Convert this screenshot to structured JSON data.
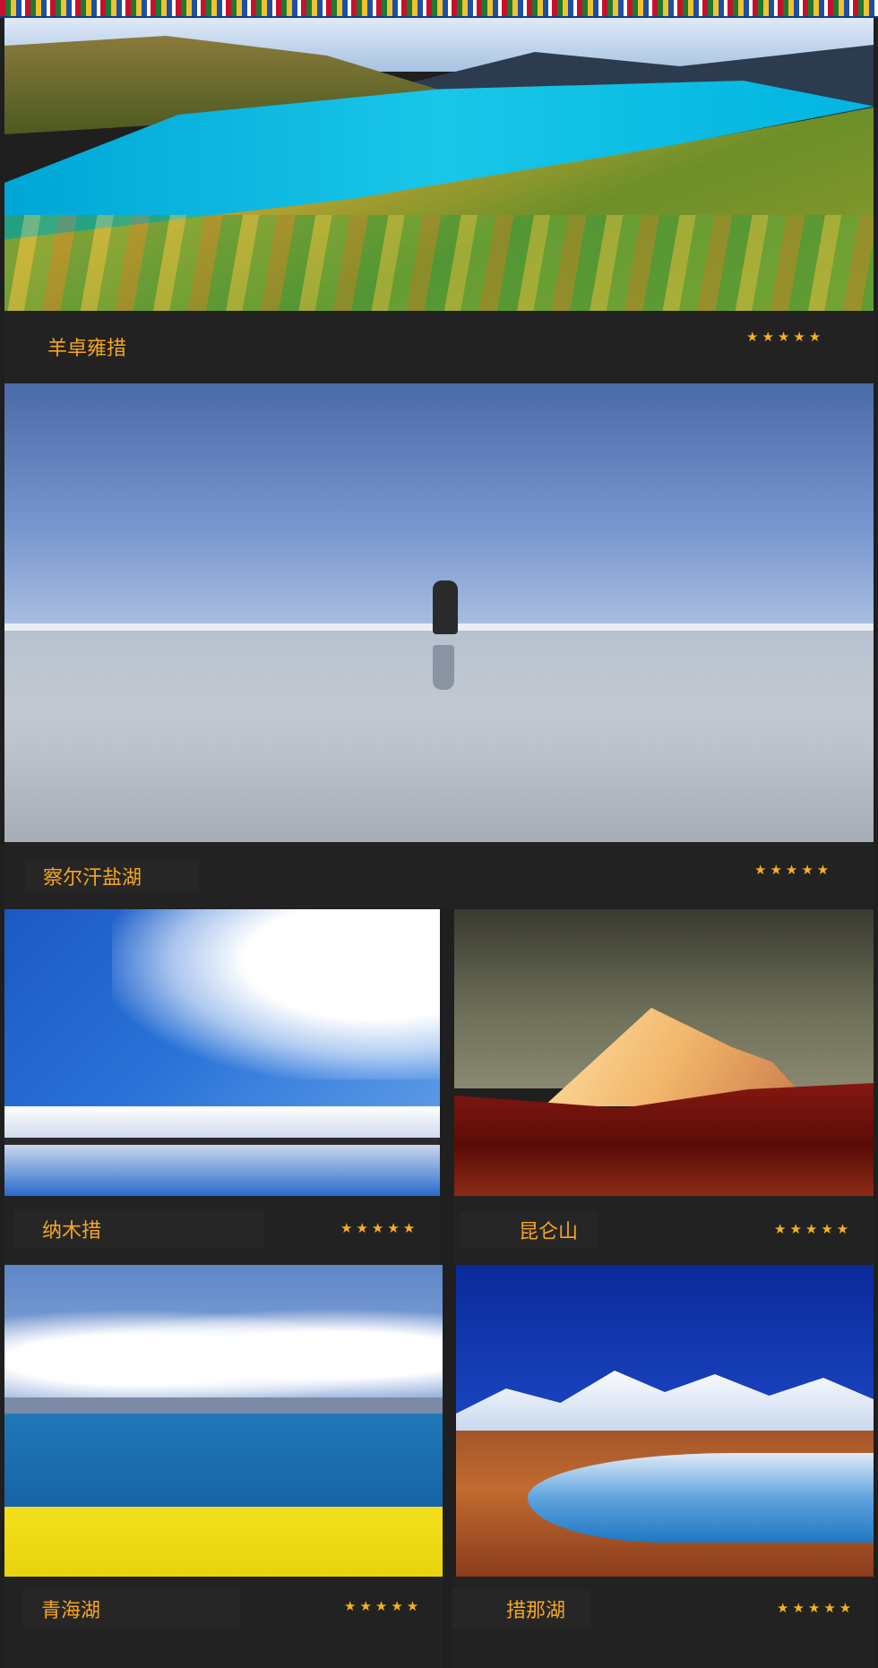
{
  "accent_color": "#f5a623",
  "star_color": "#f5b120",
  "rating_symbol": "★★★★★",
  "destinations": [
    {
      "name": "羊卓雍措",
      "rating": 5
    },
    {
      "name": "察尔汗盐湖",
      "rating": 5
    },
    {
      "name": "纳木措",
      "rating": 5
    },
    {
      "name": "昆仑山",
      "rating": 5
    },
    {
      "name": "青海湖",
      "rating": 5
    },
    {
      "name": "措那湖",
      "rating": 5
    }
  ]
}
